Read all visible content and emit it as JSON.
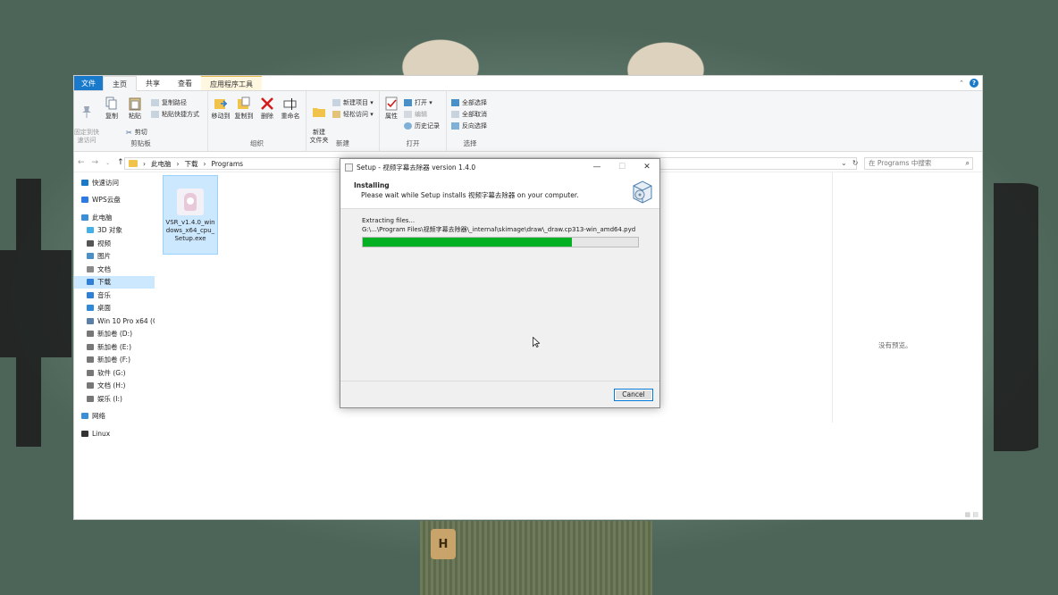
{
  "explorer": {
    "tabs": [
      {
        "label": "文件"
      },
      {
        "label": "主页"
      },
      {
        "label": "共享"
      },
      {
        "label": "查看"
      },
      {
        "label": "应用程序工具"
      }
    ],
    "ribbon": {
      "clipboard": {
        "pin_label": "固定到快\n速访问",
        "copy_label": "复制",
        "paste_label": "粘贴",
        "copy_path_label": "复制路径",
        "paste_shortcut_label": "粘贴快捷方式",
        "cut_label": "剪切",
        "group_label": "剪贴板"
      },
      "organize": {
        "move_to_label": "移动到",
        "copy_to_label": "复制到",
        "delete_label": "删除",
        "rename_label": "重命名",
        "group_label": "组织"
      },
      "new": {
        "new_folder_label": "新建\n文件夹",
        "new_item_label": "新建项目 ▾",
        "easy_access_label": "轻松访问 ▾",
        "group_label": "新建"
      },
      "open": {
        "properties_label": "属性",
        "open_label": "打开 ▾",
        "edit_label": "编辑",
        "history_label": "历史记录",
        "group_label": "打开"
      },
      "select": {
        "select_all_label": "全部选择",
        "select_none_label": "全部取消",
        "invert_label": "反向选择",
        "group_label": "选择"
      }
    },
    "address": {
      "crumbs": [
        "此电脑",
        "下载",
        "Programs"
      ],
      "search_placeholder": "在 Programs 中搜索"
    },
    "nav": [
      {
        "label": "快速访问",
        "level": 1,
        "icon": "star-icon",
        "color": "#1979ca"
      },
      {
        "gap": true
      },
      {
        "label": "WPS云盘",
        "level": 1,
        "icon": "cloud-icon",
        "color": "#2b7be4"
      },
      {
        "gap": true
      },
      {
        "label": "此电脑",
        "level": 1,
        "icon": "computer-icon",
        "color": "#3a8fd8"
      },
      {
        "label": "3D 对象",
        "level": 2,
        "icon": "cube-icon",
        "color": "#45b0e8"
      },
      {
        "label": "视频",
        "level": 2,
        "icon": "video-icon",
        "color": "#555555"
      },
      {
        "label": "图片",
        "level": 2,
        "icon": "picture-icon",
        "color": "#4a90c8"
      },
      {
        "label": "文档",
        "level": 2,
        "icon": "document-icon",
        "color": "#8a8a8a"
      },
      {
        "label": "下载",
        "level": 2,
        "icon": "download-icon",
        "color": "#2e7fd8",
        "selected": true
      },
      {
        "label": "音乐",
        "level": 2,
        "icon": "music-icon",
        "color": "#2e7fd8"
      },
      {
        "label": "桌面",
        "level": 2,
        "icon": "desktop-icon",
        "color": "#2e8ad8"
      },
      {
        "label": "Win 10 Pro x64 (C",
        "level": 2,
        "icon": "drive-icon",
        "color": "#5a7fa8"
      },
      {
        "label": "新加卷 (D:)",
        "level": 2,
        "icon": "drive-icon",
        "color": "#777777"
      },
      {
        "label": "新加卷 (E:)",
        "level": 2,
        "icon": "drive-icon",
        "color": "#777777"
      },
      {
        "label": "新加卷 (F:)",
        "level": 2,
        "icon": "drive-icon",
        "color": "#777777"
      },
      {
        "label": "软件 (G:)",
        "level": 2,
        "icon": "drive-icon",
        "color": "#777777"
      },
      {
        "label": "文档 (H:)",
        "level": 2,
        "icon": "drive-icon",
        "color": "#777777"
      },
      {
        "label": "娱乐 (I:)",
        "level": 2,
        "icon": "drive-icon",
        "color": "#777777"
      },
      {
        "gap": true
      },
      {
        "label": "网络",
        "level": 1,
        "icon": "network-icon",
        "color": "#3a8fd8"
      },
      {
        "gap": true
      },
      {
        "label": "Linux",
        "level": 1,
        "icon": "linux-icon",
        "color": "#333333"
      }
    ],
    "file": {
      "name_line1": "VSR_v1.4.0_win",
      "name_line2": "dows_x64_cpu_",
      "name_line3": "Setup.exe"
    },
    "preview_text": "没有预览。"
  },
  "setup": {
    "title": "Setup - 视频字幕去除器 version 1.4.0",
    "heading": "Installing",
    "subheading": "Please wait while Setup installs 视频字幕去除器 on your computer.",
    "extract_label": "Extracting files...",
    "extract_path": "G:\\...\\Program Files\\视频字幕去除器\\_internal\\skimage\\draw\\_draw.cp313-win_amd64.pyd",
    "progress": 0.76,
    "cancel_label": "Cancel",
    "accent_color": "#06b025"
  },
  "wallpaper": {
    "patch_letter": "H"
  }
}
